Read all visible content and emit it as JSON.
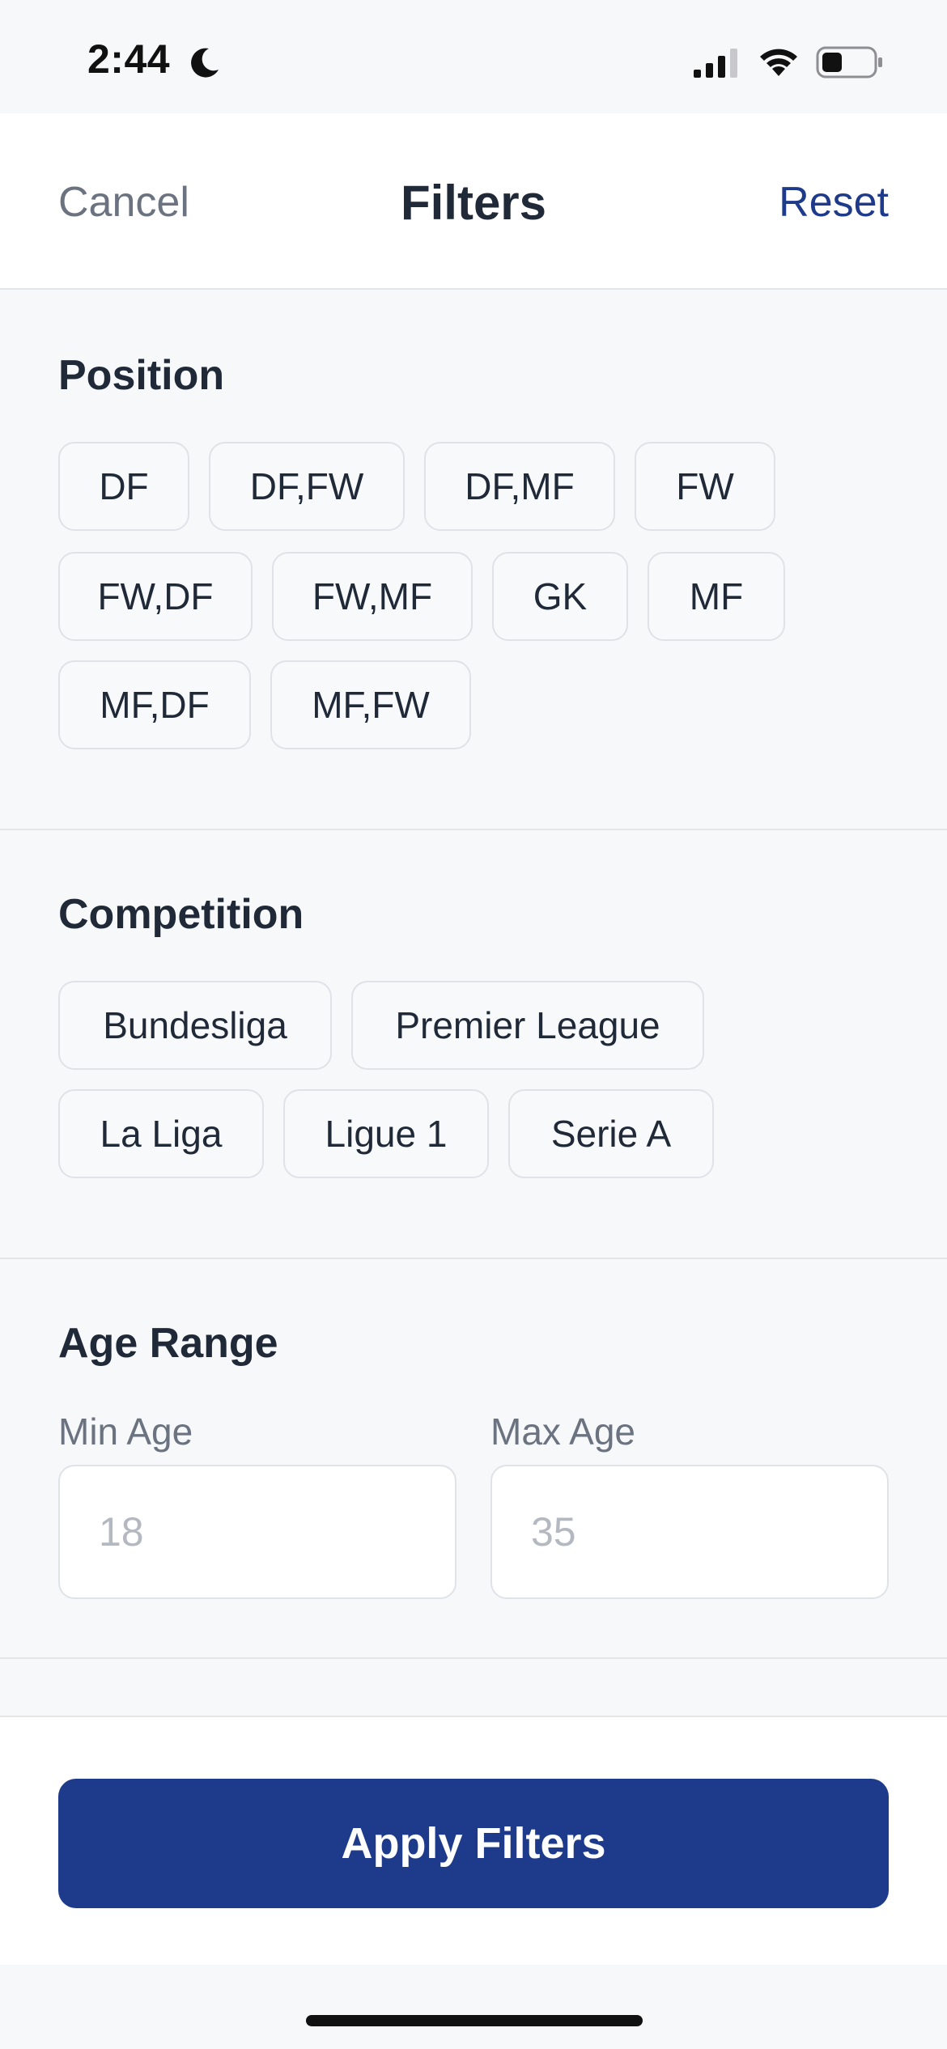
{
  "status_bar": {
    "time": "2:44",
    "icons": [
      "moon-icon",
      "signal-icon",
      "wifi-icon",
      "battery-icon"
    ]
  },
  "header": {
    "cancel_label": "Cancel",
    "title": "Filters",
    "reset_label": "Reset"
  },
  "position": {
    "title": "Position",
    "options": [
      "DF",
      "DF,FW",
      "DF,MF",
      "FW",
      "FW,DF",
      "FW,MF",
      "GK",
      "MF",
      "MF,DF",
      "MF,FW"
    ]
  },
  "competition": {
    "title": "Competition",
    "options": [
      "Bundesliga",
      "Premier League",
      "La Liga",
      "Ligue 1",
      "Serie A"
    ]
  },
  "age_range": {
    "title": "Age Range",
    "min_label": "Min Age",
    "min_placeholder": "18",
    "max_label": "Max Age",
    "max_placeholder": "35"
  },
  "footer": {
    "apply_label": "Apply Filters"
  },
  "colors": {
    "accent": "#1e3a8a",
    "background": "#f7f8fa",
    "chip_border": "#dfe2e7"
  }
}
